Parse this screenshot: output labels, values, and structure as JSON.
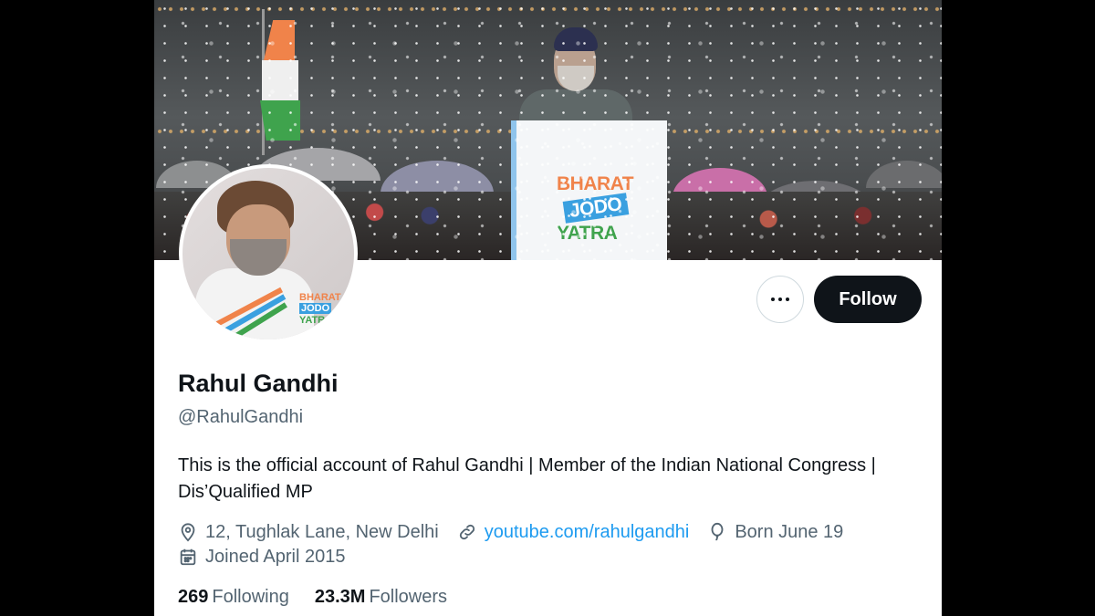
{
  "profile": {
    "name": "Rahul Gandhi",
    "handle": "@RahulGandhi",
    "bio": "This is the official account of Rahul Gandhi | Member of the Indian National Congress | Dis’Qualified MP",
    "location": "12, Tughlak Lane, New Delhi",
    "website": "youtube.com/rahulgandhi",
    "birthday": "Born June 19",
    "joined": "Joined April 2015",
    "following_count": "269",
    "following_label": "Following",
    "followers_count": "23.3M",
    "followers_label": "Followers"
  },
  "actions": {
    "follow_label": "Follow",
    "more_icon": "ellipsis-icon"
  },
  "banner": {
    "logo_line1": "BHARAT",
    "logo_line2": "JODO",
    "logo_line3": "YATRA"
  },
  "colors": {
    "follow_button_bg": "#0f1419",
    "link": "#1d9bf0",
    "secondary_text": "#536471",
    "logo_orange": "#f0834a",
    "logo_blue": "#3aa0e0",
    "logo_green": "#3fa34d"
  },
  "icons": {
    "location": "location-pin-icon",
    "link": "link-icon",
    "birthday": "balloon-icon",
    "joined": "calendar-icon"
  }
}
